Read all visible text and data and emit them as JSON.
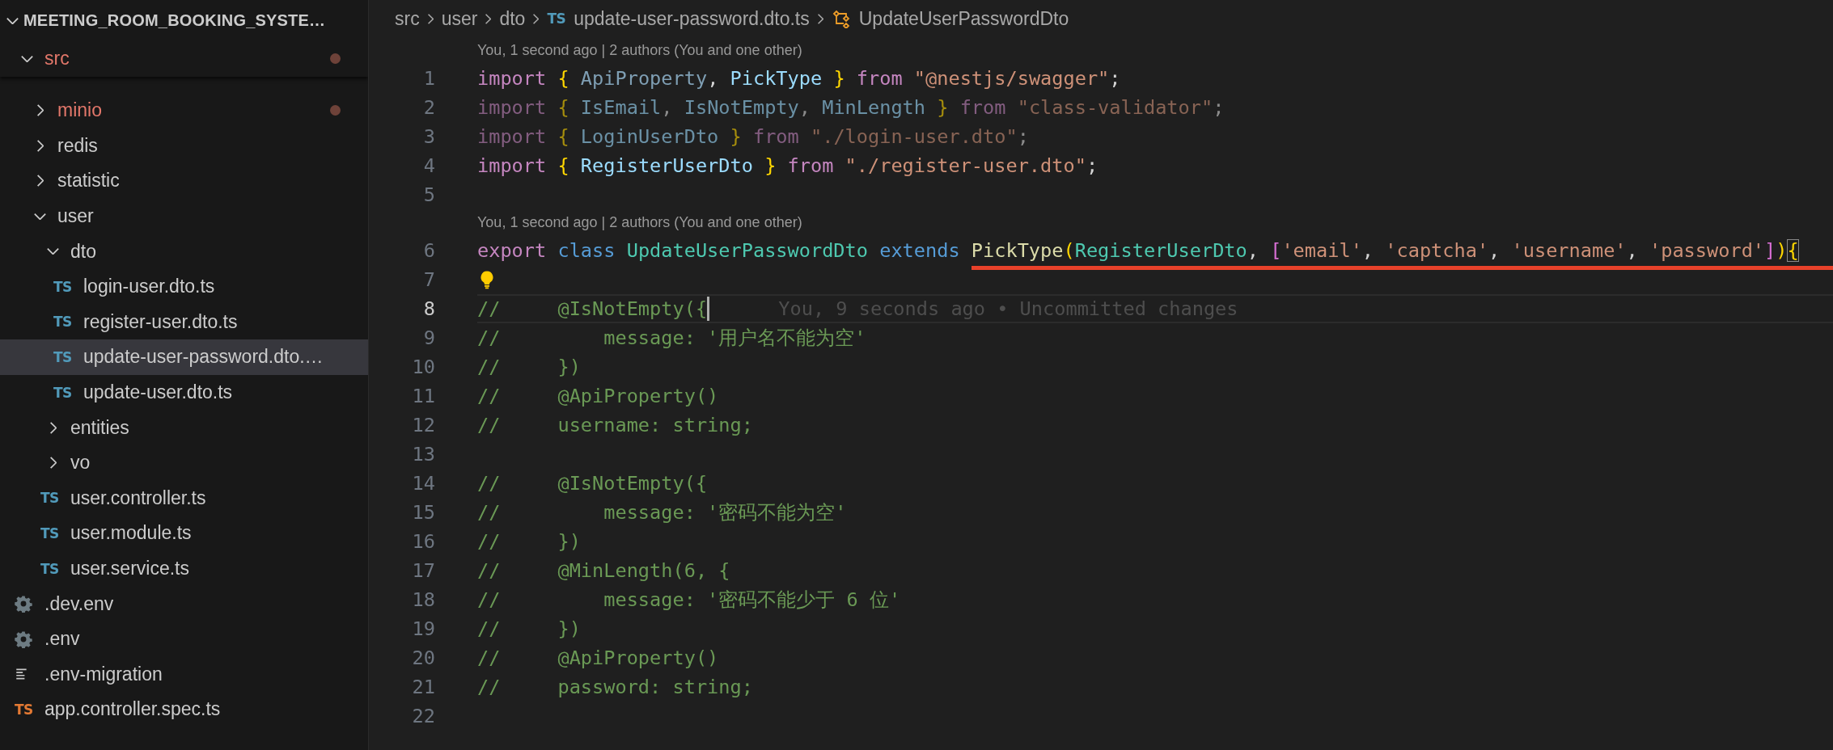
{
  "explorer": {
    "root": {
      "label": "MEETING_ROOM_BOOKING_SYSTE…",
      "expanded": true,
      "children": [
        {
          "label": "src",
          "kind": "folder",
          "expanded": true,
          "modified": true,
          "sticky": true,
          "children": [
            {
              "label": "minio",
              "kind": "folder",
              "expanded": false,
              "modified": true
            },
            {
              "label": "redis",
              "kind": "folder",
              "expanded": false,
              "modified": false
            },
            {
              "label": "statistic",
              "kind": "folder",
              "expanded": false,
              "modified": false
            },
            {
              "label": "user",
              "kind": "folder",
              "expanded": true,
              "modified": false,
              "children": [
                {
                  "label": "dto",
                  "kind": "folder",
                  "expanded": true,
                  "modified": false,
                  "children": [
                    {
                      "label": "login-user.dto.ts",
                      "kind": "ts",
                      "icon_text": "TS",
                      "selected": false,
                      "modified": false
                    },
                    {
                      "label": "register-user.dto.ts",
                      "kind": "ts",
                      "icon_text": "TS",
                      "selected": false,
                      "modified": false
                    },
                    {
                      "label": "update-user-password.dto.…",
                      "kind": "ts",
                      "icon_text": "TS",
                      "selected": true,
                      "modified": false
                    },
                    {
                      "label": "update-user.dto.ts",
                      "kind": "ts",
                      "icon_text": "TS",
                      "selected": false,
                      "modified": false
                    }
                  ]
                },
                {
                  "label": "entities",
                  "kind": "folder",
                  "expanded": false,
                  "modified": false
                },
                {
                  "label": "vo",
                  "kind": "folder",
                  "expanded": false,
                  "modified": false
                },
                {
                  "label": "user.controller.ts",
                  "kind": "ts",
                  "icon_text": "TS",
                  "selected": false,
                  "modified": false
                },
                {
                  "label": "user.module.ts",
                  "kind": "ts",
                  "icon_text": "TS",
                  "selected": false,
                  "modified": false
                },
                {
                  "label": "user.service.ts",
                  "kind": "ts",
                  "icon_text": "TS",
                  "selected": false,
                  "modified": false
                }
              ]
            }
          ]
        },
        {
          "label": ".dev.env",
          "kind": "settings",
          "selected": false,
          "modified": false
        },
        {
          "label": ".env",
          "kind": "settings",
          "selected": false,
          "modified": false
        },
        {
          "label": ".env-migration",
          "kind": "text",
          "selected": false,
          "modified": false
        },
        {
          "label": "app.controller.spec.ts",
          "kind": "ts-test",
          "icon_text": "TS",
          "selected": false,
          "modified": false
        }
      ]
    }
  },
  "breadcrumb": [
    {
      "label": "src",
      "kind": "folder"
    },
    {
      "label": "user",
      "kind": "folder"
    },
    {
      "label": "dto",
      "kind": "folder"
    },
    {
      "label": "update-user-password.dto.ts",
      "kind": "ts",
      "icon_text": "TS"
    },
    {
      "label": "UpdateUserPasswordDto",
      "kind": "class"
    }
  ],
  "editor": {
    "lines": [
      {
        "kind": "lens",
        "text": "You, 1 second ago | 2 authors (You and one other)"
      },
      {
        "kind": "code",
        "number": "1",
        "current": false,
        "faded": false,
        "underlined": false,
        "tokens": [
          {
            "text": "import",
            "kind": "keyword"
          },
          {
            "text": " {",
            "kind": "brace"
          },
          {
            "text": " ApiProperty",
            "kind": "unused"
          },
          {
            "text": ", ",
            "kind": "plain"
          },
          {
            "text": "PickType",
            "kind": "var"
          },
          {
            "text": " }",
            "kind": "brace"
          },
          {
            "text": " from",
            "kind": "keyword"
          },
          {
            "text": " \"@nestjs/swagger\"",
            "kind": "string"
          },
          {
            "text": ";",
            "kind": "plain"
          }
        ]
      },
      {
        "kind": "code",
        "number": "2",
        "current": false,
        "faded": true,
        "underlined": false,
        "tokens": [
          {
            "text": "import",
            "kind": "keyword"
          },
          {
            "text": " {",
            "kind": "brace"
          },
          {
            "text": " IsEmail",
            "kind": "var"
          },
          {
            "text": ", ",
            "kind": "plain"
          },
          {
            "text": "IsNotEmpty",
            "kind": "var"
          },
          {
            "text": ", ",
            "kind": "plain"
          },
          {
            "text": "MinLength",
            "kind": "var"
          },
          {
            "text": " }",
            "kind": "brace"
          },
          {
            "text": " from",
            "kind": "keyword"
          },
          {
            "text": " \"class-validator\"",
            "kind": "string"
          },
          {
            "text": ";",
            "kind": "plain"
          }
        ]
      },
      {
        "kind": "code",
        "number": "3",
        "current": false,
        "faded": true,
        "underlined": false,
        "tokens": [
          {
            "text": "import",
            "kind": "keyword"
          },
          {
            "text": " {",
            "kind": "brace"
          },
          {
            "text": " LoginUserDto",
            "kind": "var"
          },
          {
            "text": " }",
            "kind": "brace"
          },
          {
            "text": " from",
            "kind": "keyword"
          },
          {
            "text": " \"./login-user.dto\"",
            "kind": "string"
          },
          {
            "text": ";",
            "kind": "plain"
          }
        ]
      },
      {
        "kind": "code",
        "number": "4",
        "current": false,
        "faded": false,
        "underlined": false,
        "tokens": [
          {
            "text": "import",
            "kind": "keyword"
          },
          {
            "text": " {",
            "kind": "brace"
          },
          {
            "text": " RegisterUserDto",
            "kind": "var"
          },
          {
            "text": " }",
            "kind": "brace"
          },
          {
            "text": " from",
            "kind": "keyword"
          },
          {
            "text": " \"./register-user.dto\"",
            "kind": "string"
          },
          {
            "text": ";",
            "kind": "plain"
          }
        ]
      },
      {
        "kind": "code",
        "number": "5",
        "current": false
      },
      {
        "kind": "lens",
        "text": "You, 1 second ago | 2 authors (You and one other)"
      },
      {
        "kind": "code",
        "number": "6",
        "current": false,
        "faded": false,
        "underlined": true,
        "tokens": [
          {
            "text": "export",
            "kind": "keyword"
          },
          {
            "text": " class",
            "kind": "storage"
          },
          {
            "text": " UpdateUserPasswordDto",
            "kind": "class"
          },
          {
            "text": " extends",
            "kind": "storage"
          },
          {
            "text": " PickType",
            "kind": "func"
          },
          {
            "text": "(",
            "kind": "brace"
          },
          {
            "text": "RegisterUserDto",
            "kind": "class"
          },
          {
            "text": ", ",
            "kind": "plain"
          },
          {
            "text": "[",
            "kind": "bracket2"
          },
          {
            "text": "'email'",
            "kind": "string"
          },
          {
            "text": ", ",
            "kind": "plain"
          },
          {
            "text": "'captcha'",
            "kind": "string"
          },
          {
            "text": ", ",
            "kind": "plain"
          },
          {
            "text": "'username'",
            "kind": "string"
          },
          {
            "text": ", ",
            "kind": "plain"
          },
          {
            "text": "'password'",
            "kind": "string"
          },
          {
            "text": "]",
            "kind": "bracket2"
          },
          {
            "text": ")",
            "kind": "brace"
          },
          {
            "text": "{",
            "kind": "brace-match"
          }
        ]
      },
      {
        "kind": "code",
        "number": "7",
        "current": false,
        "faded": false,
        "underlined": false,
        "tokens": [
          {
            "kind": "lightbulb"
          }
        ]
      },
      {
        "kind": "code",
        "number": "8",
        "current": true,
        "faded": false,
        "underlined": false,
        "tokens": [
          {
            "text": "//     @IsNotEmpty({",
            "kind": "comment"
          },
          {
            "kind": "cursor"
          },
          {
            "text": "You, 9 seconds ago • Uncommitted changes",
            "kind": "blame"
          }
        ]
      },
      {
        "kind": "code",
        "number": "9",
        "current": false,
        "faded": false,
        "underlined": false,
        "tokens": [
          {
            "text": "//         message: '用户名不能为空'",
            "kind": "comment"
          }
        ]
      },
      {
        "kind": "code",
        "number": "10",
        "current": false,
        "faded": false,
        "underlined": false,
        "tokens": [
          {
            "text": "//     })",
            "kind": "comment"
          }
        ]
      },
      {
        "kind": "code",
        "number": "11",
        "current": false,
        "faded": false,
        "underlined": false,
        "tokens": [
          {
            "text": "//     @ApiProperty()",
            "kind": "comment"
          }
        ]
      },
      {
        "kind": "code",
        "number": "12",
        "current": false,
        "faded": false,
        "underlined": false,
        "tokens": [
          {
            "text": "//     username: string;",
            "kind": "comment"
          }
        ]
      },
      {
        "kind": "code",
        "number": "13",
        "current": false
      },
      {
        "kind": "code",
        "number": "14",
        "current": false,
        "faded": false,
        "underlined": false,
        "tokens": [
          {
            "text": "//     @IsNotEmpty({",
            "kind": "comment"
          }
        ]
      },
      {
        "kind": "code",
        "number": "15",
        "current": false,
        "faded": false,
        "underlined": false,
        "tokens": [
          {
            "text": "//         message: '密码不能为空'",
            "kind": "comment"
          }
        ]
      },
      {
        "kind": "code",
        "number": "16",
        "current": false,
        "faded": false,
        "underlined": false,
        "tokens": [
          {
            "text": "//     })",
            "kind": "comment"
          }
        ]
      },
      {
        "kind": "code",
        "number": "17",
        "current": false,
        "faded": false,
        "underlined": false,
        "tokens": [
          {
            "text": "//     @MinLength(6, {",
            "kind": "comment"
          }
        ]
      },
      {
        "kind": "code",
        "number": "18",
        "current": false,
        "faded": false,
        "underlined": false,
        "tokens": [
          {
            "text": "//         message: '密码不能少于 6 位'",
            "kind": "comment"
          }
        ]
      },
      {
        "kind": "code",
        "number": "19",
        "current": false,
        "faded": false,
        "underlined": false,
        "tokens": [
          {
            "text": "//     })",
            "kind": "comment"
          }
        ]
      },
      {
        "kind": "code",
        "number": "20",
        "current": false,
        "faded": false,
        "underlined": false,
        "tokens": [
          {
            "text": "//     @ApiProperty()",
            "kind": "comment"
          }
        ]
      },
      {
        "kind": "code",
        "number": "21",
        "current": false,
        "faded": false,
        "underlined": false,
        "tokens": [
          {
            "text": "//     password: string;",
            "kind": "comment"
          }
        ]
      },
      {
        "kind": "code",
        "number": "22",
        "current": false
      }
    ]
  }
}
